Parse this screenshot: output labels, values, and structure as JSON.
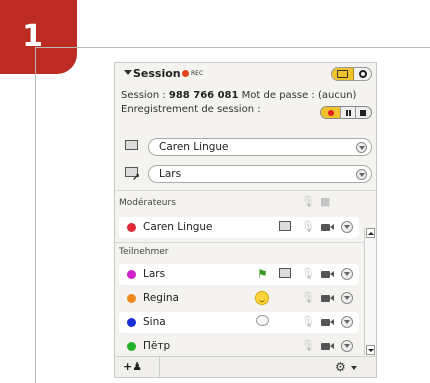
{
  "step": {
    "number": "1"
  },
  "header": {
    "title": "Session",
    "rec_label": "REC"
  },
  "session": {
    "session_label": "Session :",
    "session_number": "988 766 081",
    "password_label": "Mot de passe :",
    "password_value": "(aucun)",
    "recording_label": "Enregistrement de session :"
  },
  "selects": {
    "screen_share_user": "Caren Lingue",
    "remote_control_user": "Lars"
  },
  "moderators": {
    "header": "Modérateurs",
    "items": [
      {
        "name": "Caren Lingue",
        "color": "#e02838"
      }
    ]
  },
  "participants": {
    "header": "Teilnehmer",
    "items": [
      {
        "name": "Lars",
        "color": "#d321c9"
      },
      {
        "name": "Regina",
        "color": "#f08a1c"
      },
      {
        "name": "Sina",
        "color": "#1a2ed6"
      },
      {
        "name": "Пётр",
        "color": "#22b22a"
      }
    ]
  },
  "footer": {
    "add_label": "+"
  },
  "colors": {
    "brand": "#bd2c23",
    "accent": "#f0c22c"
  }
}
